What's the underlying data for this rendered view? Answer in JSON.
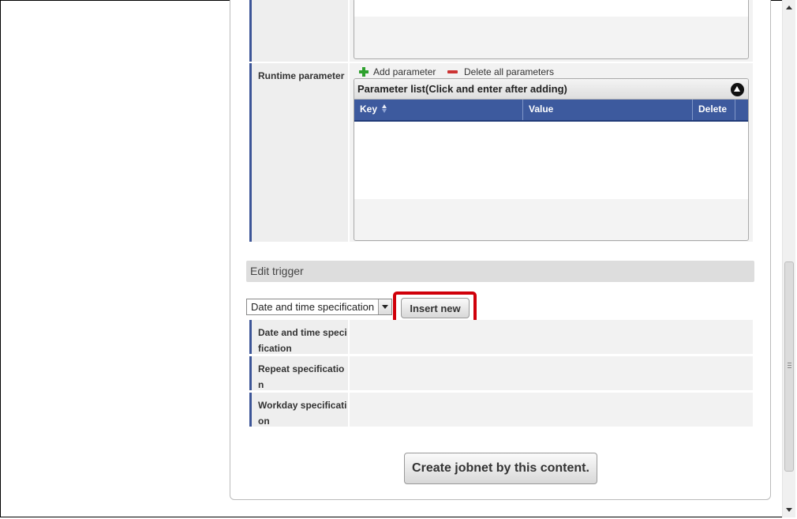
{
  "runtime_parameter": {
    "label": "Runtime parameter",
    "toolbar": {
      "add_label": "Add parameter",
      "delete_all_label": "Delete all parameters"
    },
    "grid": {
      "title": "Parameter list(Click and enter after adding)",
      "columns": [
        "Key",
        "Value",
        "Delete"
      ]
    }
  },
  "edit_trigger": {
    "section_title": "Edit trigger",
    "trigger_select": {
      "selected": "Date and time specification"
    },
    "insert_button_label": "Insert new",
    "rows": [
      {
        "label": "Date and time specification"
      },
      {
        "label": "Repeat specification"
      },
      {
        "label": "Workday specification"
      }
    ]
  },
  "create_button_label": "Create jobnet by this content.",
  "colors": {
    "accent": "#3d5a9e",
    "highlight": "#d0000a",
    "add_icon": "#2ea12e",
    "delete_icon": "#cc3333"
  },
  "icons": {
    "add": "plus-icon",
    "delete": "minus-icon",
    "collapse": "chevron-up-icon",
    "sort": "sort-icon"
  }
}
